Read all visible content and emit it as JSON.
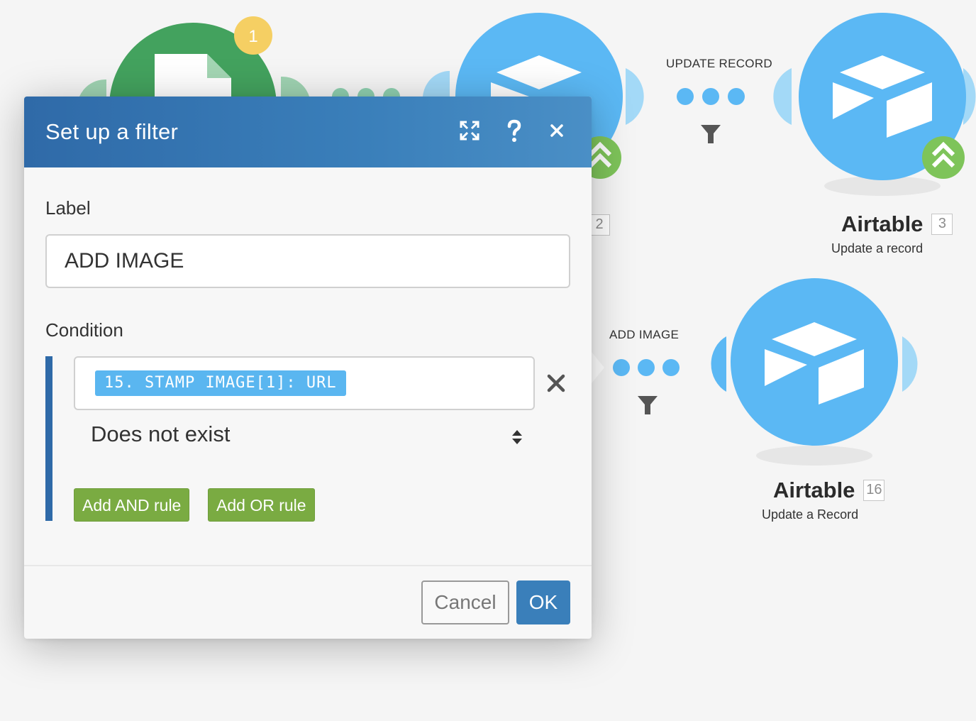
{
  "canvas": {
    "trigger_badge_count": "1",
    "modules": [
      {
        "title": "Airtable",
        "number": "3",
        "subtitle": "Update a record"
      },
      {
        "title": "Airtable",
        "number": "16",
        "subtitle": "Update a Record"
      }
    ],
    "partial_module_number": "2",
    "routes": [
      {
        "label": "UPDATE RECORD"
      },
      {
        "label": "ADD IMAGE"
      }
    ]
  },
  "dialog": {
    "title": "Set up a filter",
    "label_caption": "Label",
    "label_value": "ADD IMAGE",
    "condition_caption": "Condition",
    "operand_pill": "15. STAMP IMAGE[1]: URL",
    "operator": "Does not exist",
    "add_and_label": "Add AND rule",
    "add_or_label": "Add OR rule",
    "cancel_label": "Cancel",
    "ok_label": "OK"
  },
  "colors": {
    "airtable_blue": "#5bb8f4",
    "header_blue": "#2f6aa8",
    "green_button": "#7aab42",
    "trigger_green": "#43a25e",
    "badge_yellow": "#f5cf63"
  }
}
